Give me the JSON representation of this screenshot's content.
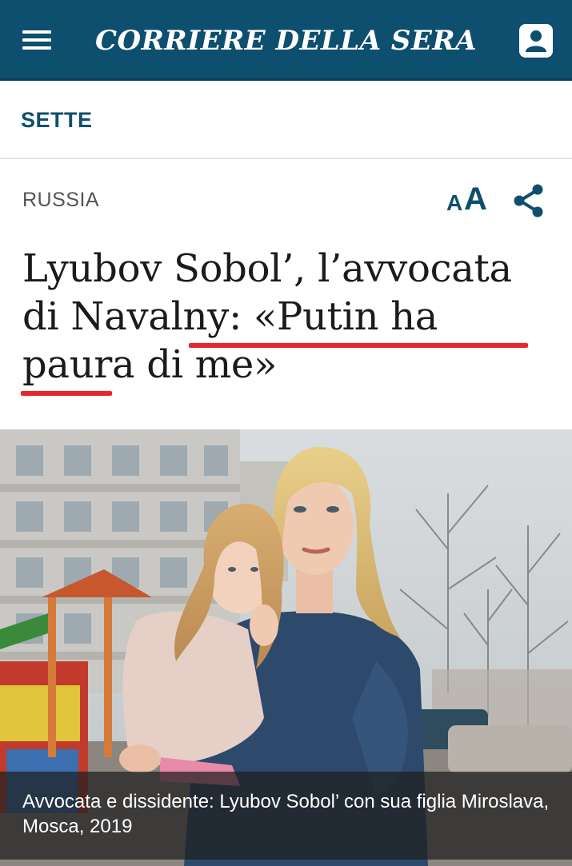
{
  "header": {
    "brand": "CORRIERE DELLA SERA",
    "menu_icon": "hamburger-menu-icon",
    "account_icon": "user-account-icon"
  },
  "section": {
    "label": "SETTE"
  },
  "article": {
    "category": "RUSSIA",
    "font_size_small": "A",
    "font_size_large": "A",
    "share_icon": "share-icon",
    "headline_part1": "Lyubov Sobol’, l’avvocata di Navalny: ",
    "headline_quote": "«Putin ha paura di me»",
    "photo_caption": "Avvocata e dissidente: Lyubov Sobol’ con sua figlia Miroslava, Mosca, 2019"
  },
  "colors": {
    "brand_blue": "#0e4f6f",
    "highlight_red": "#e8262e",
    "text_dark": "#1b1b1b",
    "category_gray": "#555555"
  }
}
